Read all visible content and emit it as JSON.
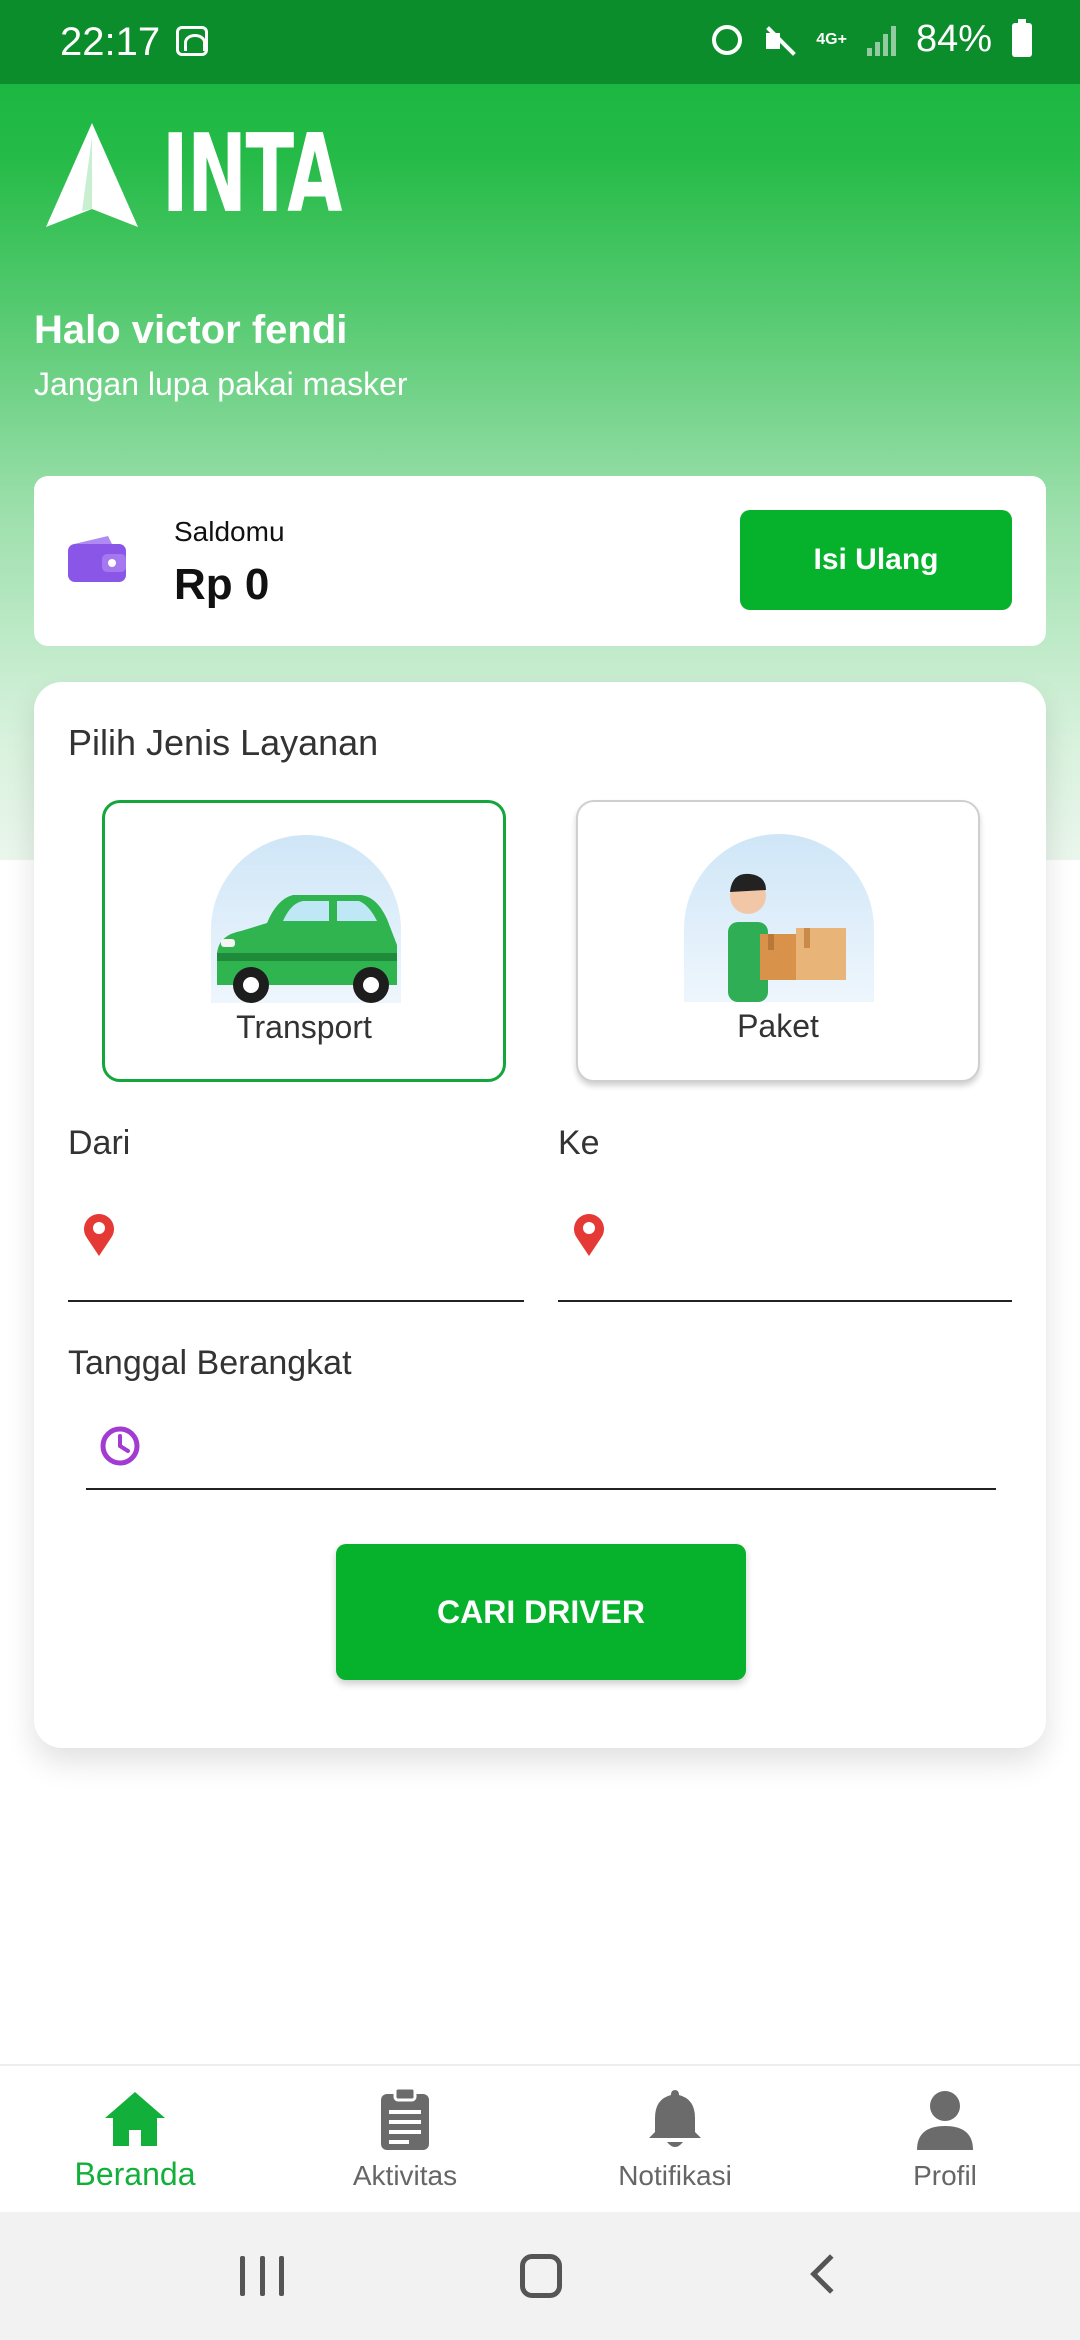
{
  "status_bar": {
    "time": "22:17",
    "network": "4G+",
    "battery": "84%",
    "icons": [
      "wifi-icon",
      "alarm-icon",
      "mute-icon",
      "signal-icon",
      "battery-icon"
    ]
  },
  "brand": {
    "wordmark": "INTA"
  },
  "greeting": {
    "title": "Halo victor fendi",
    "subtitle": "Jangan lupa pakai masker"
  },
  "balance": {
    "label": "Saldomu",
    "value": "Rp 0",
    "topup_label": "Isi Ulang"
  },
  "service": {
    "title": "Pilih Jenis Layanan",
    "options": [
      {
        "label": "Transport",
        "selected": true,
        "icon": "car-icon"
      },
      {
        "label": "Paket",
        "selected": false,
        "icon": "courier-package-icon"
      }
    ],
    "from_label": "Dari",
    "to_label": "Ke",
    "from_value": "",
    "to_value": "",
    "date_label": "Tanggal Berangkat",
    "date_value": "",
    "submit_label": "CARI DRIVER"
  },
  "bottom_nav": [
    {
      "label": "Beranda",
      "icon": "home-icon",
      "active": true
    },
    {
      "label": "Aktivitas",
      "icon": "clipboard-icon",
      "active": false
    },
    {
      "label": "Notifikasi",
      "icon": "bell-icon",
      "active": false
    },
    {
      "label": "Profil",
      "icon": "profile-icon",
      "active": false
    }
  ],
  "colors": {
    "brand_green": "#06b12c",
    "status_bar": "#0c8d2c",
    "active_nav": "#12b03b",
    "pin_red": "#e53935",
    "clock_purple": "#a23bd1"
  }
}
